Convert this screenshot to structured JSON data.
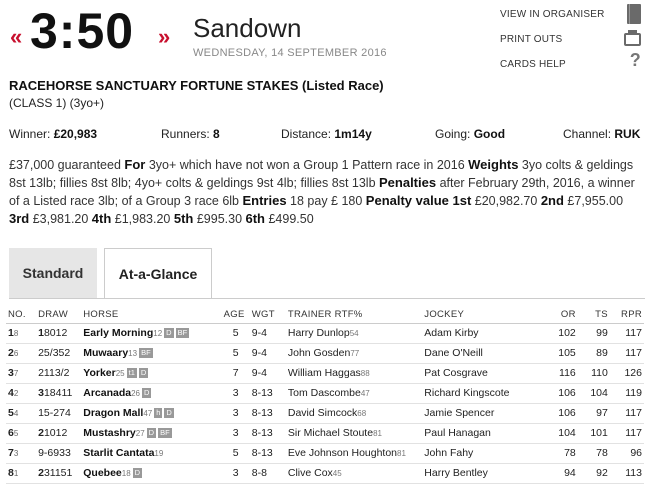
{
  "nav": {
    "prev_label": "«",
    "next_label": "»"
  },
  "race": {
    "time": "3:50",
    "course": "Sandown",
    "date": "WEDNESDAY, 14 SEPTEMBER 2016",
    "title": "RACEHORSE SANCTUARY FORTUNE STAKES (Listed Race)",
    "class": "(CLASS 1) (3yo+)"
  },
  "tools": [
    {
      "label": "VIEW IN ORGANISER",
      "icon": "book-icon"
    },
    {
      "label": "PRINT OUTS",
      "icon": "printer-icon"
    },
    {
      "label": "CARDS HELP",
      "icon": "help-icon"
    }
  ],
  "stats": {
    "winner_label": "Winner:",
    "winner": "£20,983",
    "runners_label": "Runners:",
    "runners": "8",
    "distance_label": "Distance:",
    "distance": "1m14y",
    "going_label": "Going:",
    "going": "Good",
    "channel_label": "Channel:",
    "channel": "RUK"
  },
  "conditions": [
    {
      "t": "£37,000 guaranteed ",
      "b": false
    },
    {
      "t": "For",
      "b": true
    },
    {
      "t": " 3yo+ which have not won a Group 1 Pattern race in 2016 ",
      "b": false
    },
    {
      "t": "Weights",
      "b": true
    },
    {
      "t": " 3yo colts & geldings 8st 13lb; fillies 8st 8lb; 4yo+ colts & geldings 9st 4lb; fillies 8st 13lb ",
      "b": false
    },
    {
      "t": "Penalties",
      "b": true
    },
    {
      "t": " after February 29th, 2016, a winner of a Listed race 3lb; of a Group 3 race 6lb ",
      "b": false
    },
    {
      "t": "Entries",
      "b": true
    },
    {
      "t": " 18 pay £ 180 ",
      "b": false
    },
    {
      "t": "Penalty value 1st",
      "b": true
    },
    {
      "t": " £20,982.70 ",
      "b": false
    },
    {
      "t": "2nd",
      "b": true
    },
    {
      "t": " £7,955.00 ",
      "b": false
    },
    {
      "t": "3rd",
      "b": true
    },
    {
      "t": " £3,981.20 ",
      "b": false
    },
    {
      "t": "4th",
      "b": true
    },
    {
      "t": " £1,983.20 ",
      "b": false
    },
    {
      "t": "5th",
      "b": true
    },
    {
      "t": " £995.30 ",
      "b": false
    },
    {
      "t": "6th",
      "b": true
    },
    {
      "t": " £499.50",
      "b": false
    }
  ],
  "tabs": {
    "standard": "Standard",
    "glance": "At-a-Glance"
  },
  "table": {
    "headers": {
      "no": "NO.",
      "draw": "DRAW",
      "horse": "HORSE",
      "age": "AGE",
      "wgt": "WGT",
      "trainer": "TRAINER RTF%",
      "jockey": "JOCKEY",
      "or": "OR",
      "ts": "TS",
      "rpr": "RPR"
    },
    "rows": [
      {
        "no": "1",
        "draw": "8",
        "form": "1",
        "form_rest": "8012",
        "horse": "Early Morning",
        "days": "12",
        "badges": [
          "D",
          "BF"
        ],
        "age": "5",
        "wgt": "9-4",
        "trainer": "Harry Dunlop",
        "rtf": "54",
        "jockey": "Adam Kirby",
        "or": "102",
        "ts": "99",
        "rpr": "117"
      },
      {
        "no": "2",
        "draw": "6",
        "form": "",
        "form_rest": "25/352",
        "horse": "Muwaary",
        "days": "13",
        "badges": [
          "BF"
        ],
        "age": "5",
        "wgt": "9-4",
        "trainer": "John Gosden",
        "rtf": "77",
        "jockey": "Dane O'Neill",
        "or": "105",
        "ts": "89",
        "rpr": "117"
      },
      {
        "no": "3",
        "draw": "7",
        "form": "",
        "form_rest": "2113/2",
        "horse": "Yorker",
        "days": "25",
        "badges": [
          "t1",
          "D"
        ],
        "age": "7",
        "wgt": "9-4",
        "trainer": "William Haggas",
        "rtf": "88",
        "jockey": "Pat Cosgrave",
        "or": "116",
        "ts": "110",
        "rpr": "126"
      },
      {
        "no": "4",
        "draw": "2",
        "form": "3",
        "form_rest": "18411",
        "horse": "Arcanada",
        "days": "26",
        "badges": [
          "D"
        ],
        "age": "3",
        "wgt": "8-13",
        "trainer": "Tom Dascombe",
        "rtf": "47",
        "jockey": "Richard Kingscote",
        "or": "106",
        "ts": "104",
        "rpr": "119"
      },
      {
        "no": "5",
        "draw": "4",
        "form": "",
        "form_rest": "15-274",
        "horse": "Dragon Mall",
        "days": "47",
        "badges": [
          "h",
          "D"
        ],
        "age": "3",
        "wgt": "8-13",
        "trainer": "David Simcock",
        "rtf": "68",
        "jockey": "Jamie Spencer",
        "or": "106",
        "ts": "97",
        "rpr": "117"
      },
      {
        "no": "6",
        "draw": "5",
        "form": "2",
        "form_rest": "1012",
        "horse": "Mustashry",
        "days": "27",
        "badges": [
          "D",
          "BF"
        ],
        "age": "3",
        "wgt": "8-13",
        "trainer": "Sir Michael Stoute",
        "rtf": "81",
        "jockey": "Paul Hanagan",
        "or": "104",
        "ts": "101",
        "rpr": "117"
      },
      {
        "no": "7",
        "draw": "3",
        "form": "",
        "form_rest": "9-6933",
        "horse": "Starlit Cantata",
        "days": "19",
        "badges": [],
        "age": "5",
        "wgt": "8-13",
        "trainer": "Eve Johnson Houghton",
        "rtf": "81",
        "jockey": "John Fahy",
        "or": "78",
        "ts": "78",
        "rpr": "96"
      },
      {
        "no": "8",
        "draw": "1",
        "form": "2",
        "form_rest": "31151",
        "horse": "Quebee",
        "days": "18",
        "badges": [
          "D"
        ],
        "age": "3",
        "wgt": "8-8",
        "trainer": "Clive Cox",
        "rtf": "45",
        "jockey": "Harry Bentley",
        "or": "94",
        "ts": "92",
        "rpr": "113"
      }
    ]
  }
}
